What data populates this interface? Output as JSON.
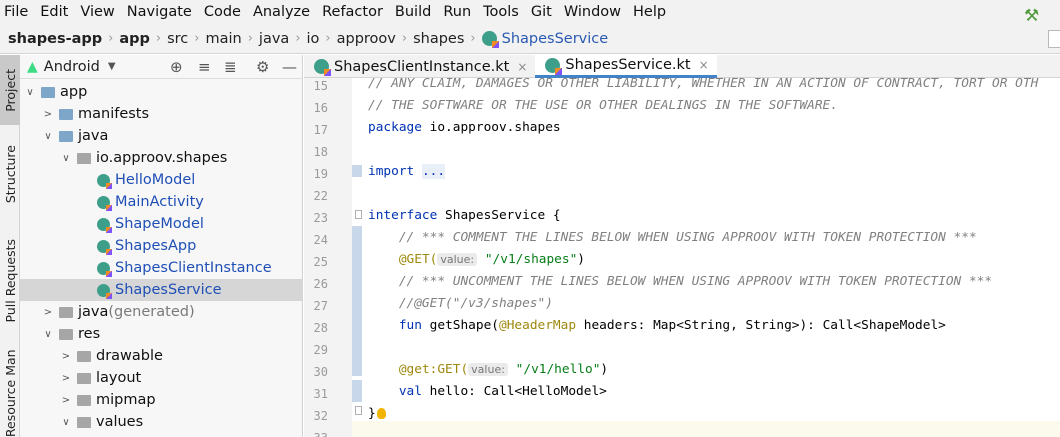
{
  "menu": [
    "File",
    "Edit",
    "View",
    "Navigate",
    "Code",
    "Analyze",
    "Refactor",
    "Build",
    "Run",
    "Tools",
    "Git",
    "Window",
    "Help"
  ],
  "breadcrumbs": [
    "shapes-app",
    "app",
    "src",
    "main",
    "java",
    "io",
    "approov",
    "shapes",
    "ShapesService"
  ],
  "left_tabs": [
    "Project",
    "Structure",
    "Pull Requests",
    "Resource Manager"
  ],
  "project_panel": {
    "view_mode": "Android",
    "tree": [
      {
        "label": "app",
        "indent": 0,
        "arrow": "down",
        "icon": "folder-blue"
      },
      {
        "label": "manifests",
        "indent": 1,
        "arrow": "right",
        "icon": "folder-blue"
      },
      {
        "label": "java",
        "indent": 1,
        "arrow": "down",
        "icon": "folder-blue"
      },
      {
        "label": "io.approov.shapes",
        "indent": 2,
        "arrow": "down",
        "icon": "folder-gray"
      },
      {
        "label": "HelloModel",
        "indent": 3,
        "arrow": "",
        "icon": "kotlin-class"
      },
      {
        "label": "MainActivity",
        "indent": 3,
        "arrow": "",
        "icon": "kotlin-class"
      },
      {
        "label": "ShapeModel",
        "indent": 3,
        "arrow": "",
        "icon": "kotlin-class"
      },
      {
        "label": "ShapesApp",
        "indent": 3,
        "arrow": "",
        "icon": "kotlin-class"
      },
      {
        "label": "ShapesClientInstance",
        "indent": 3,
        "arrow": "",
        "icon": "kotlin-object"
      },
      {
        "label": "ShapesService",
        "indent": 3,
        "arrow": "",
        "icon": "kotlin-interface",
        "selected": true
      },
      {
        "label": "java",
        "suffix": " (generated)",
        "indent": 1,
        "arrow": "right",
        "icon": "folder-gen"
      },
      {
        "label": "res",
        "indent": 1,
        "arrow": "down",
        "icon": "folder-res"
      },
      {
        "label": "drawable",
        "indent": 2,
        "arrow": "right",
        "icon": "folder-gray"
      },
      {
        "label": "layout",
        "indent": 2,
        "arrow": "right",
        "icon": "folder-gray"
      },
      {
        "label": "mipmap",
        "indent": 2,
        "arrow": "right",
        "icon": "folder-gray"
      },
      {
        "label": "values",
        "indent": 2,
        "arrow": "down",
        "icon": "folder-gray"
      }
    ]
  },
  "editor": {
    "tabs": [
      {
        "label": "ShapesClientInstance.kt",
        "active": false
      },
      {
        "label": "ShapesService.kt",
        "active": true
      }
    ],
    "line_numbers": [
      "15",
      "16",
      "17",
      "18",
      "19",
      "22",
      "23",
      "24",
      "25",
      "26",
      "27",
      "28",
      "29",
      "30",
      "31",
      "32",
      "33"
    ],
    "lines": {
      "l15": "// ANY CLAIM, DAMAGES OR OTHER LIABILITY, WHETHER IN AN ACTION OF CONTRACT, TORT OR OTH",
      "l16": "// THE SOFTWARE OR THE USE OR OTHER DEALINGS IN THE SOFTWARE.",
      "l17_kw": "package",
      "l17_rest": " io.approov.shapes",
      "l19_kw": "import",
      "l19_dots": "...",
      "l23_kw": "interface",
      "l23_rest": " ShapesService {",
      "l24": "    // *** COMMENT THE LINES BELOW WHEN USING APPROOV WITH TOKEN PROTECTION ***",
      "l25_ann": "@GET(",
      "l25_hint": "value:",
      "l25_str": "\"/v1/shapes\"",
      "l25_end": ")",
      "l26": "    // *** UNCOMMENT THE LINES BELOW WHEN USING APPROOV WITH TOKEN PROTECTION ***",
      "l27": "    //@GET(\"/v3/shapes\")",
      "l28_kw": "fun",
      "l28_fn": " getShape(",
      "l28_ann": "@HeaderMap",
      "l28_rest": " headers: Map<String, String>): Call<ShapeModel>",
      "l30_ann": "@get:GET(",
      "l30_hint": "value:",
      "l30_str": "\"/v1/hello\"",
      "l30_end": ")",
      "l31_kw": "val",
      "l31_rest": " hello: Call<HelloModel>",
      "l32": "}"
    }
  }
}
